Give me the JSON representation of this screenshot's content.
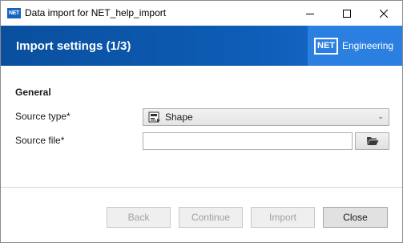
{
  "window": {
    "app_icon_text": "NET",
    "title": "Data import for NET_help_import",
    "minimize_icon": "minimize-icon",
    "maximize_icon": "maximize-icon",
    "close_icon": "close-icon"
  },
  "banner": {
    "title": "Import settings (1/3)",
    "logo_box": "NET",
    "logo_text": "Engineering",
    "colors": {
      "banner": "#0d5cb5",
      "logo_bg": "#2b7fe0"
    }
  },
  "form": {
    "section": "General",
    "source_type": {
      "label": "Source type*",
      "value": "Shape",
      "icon": "shapefile-icon"
    },
    "source_file": {
      "label": "Source file*",
      "value": "",
      "placeholder": "",
      "browse_icon": "folder-open-icon"
    }
  },
  "footer": {
    "back": "Back",
    "continue": "Continue",
    "import": "Import",
    "close": "Close"
  }
}
